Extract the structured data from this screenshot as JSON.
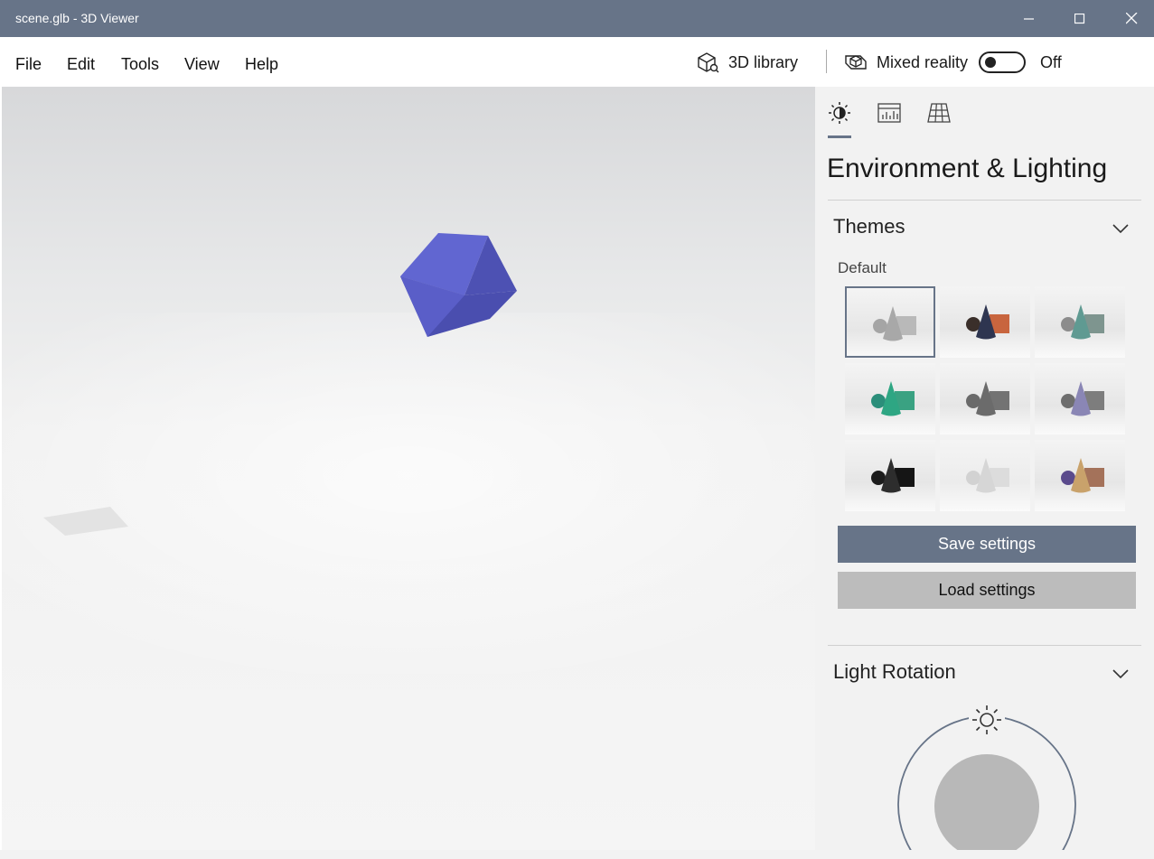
{
  "window": {
    "title": "scene.glb - 3D Viewer"
  },
  "menu": {
    "items": [
      "File",
      "Edit",
      "Tools",
      "View",
      "Help"
    ]
  },
  "toolbar": {
    "library_label": "3D library",
    "mixed_reality_label": "Mixed reality",
    "mixed_reality_state": "Off"
  },
  "panel": {
    "tabs": [
      "environment-lighting",
      "stats-shading",
      "grid-views"
    ],
    "title": "Environment & Lighting",
    "themes": {
      "header": "Themes",
      "default_label": "Default",
      "selected_index": 0,
      "swatches": [
        {
          "bg": "#e6e6e6",
          "cone": "#a8a8a8",
          "box": "#b9b9b9",
          "sphere": "#a5a5a5"
        },
        {
          "bg": "#e6e6e6",
          "cone": "#2e3550",
          "box": "#c8653e",
          "sphere": "#3a2f2a"
        },
        {
          "bg": "#e6e6e6",
          "cone": "#5f9a92",
          "box": "#7e958f",
          "sphere": "#8c8c8c"
        },
        {
          "bg": "#e6e6e6",
          "cone": "#2ea683",
          "box": "#3aa282",
          "sphere": "#2b8e7a"
        },
        {
          "bg": "#e6e6e6",
          "cone": "#6b6b6b",
          "box": "#737373",
          "sphere": "#6a6a6a"
        },
        {
          "bg": "#e6e6e6",
          "cone": "#8a86b5",
          "box": "#7d7d7d",
          "sphere": "#6e6e6e"
        },
        {
          "bg": "#e6e6e6",
          "cone": "#2d2d2d",
          "box": "#151515",
          "sphere": "#1c1c1c"
        },
        {
          "bg": "#ececec",
          "cone": "#d6d6d6",
          "box": "#dcdcdc",
          "sphere": "#d2d2d2"
        },
        {
          "bg": "#e6e6e6",
          "cone": "#c9a26b",
          "box": "#a4725a",
          "sphere": "#5a4a8c"
        }
      ]
    },
    "save_label": "Save settings",
    "load_label": "Load settings",
    "light_rotation": {
      "header": "Light Rotation"
    }
  },
  "colors": {
    "accent": "#677488",
    "cube": "#5b5fc7",
    "board_dark": "#111111",
    "board_light": "#ffffff"
  }
}
